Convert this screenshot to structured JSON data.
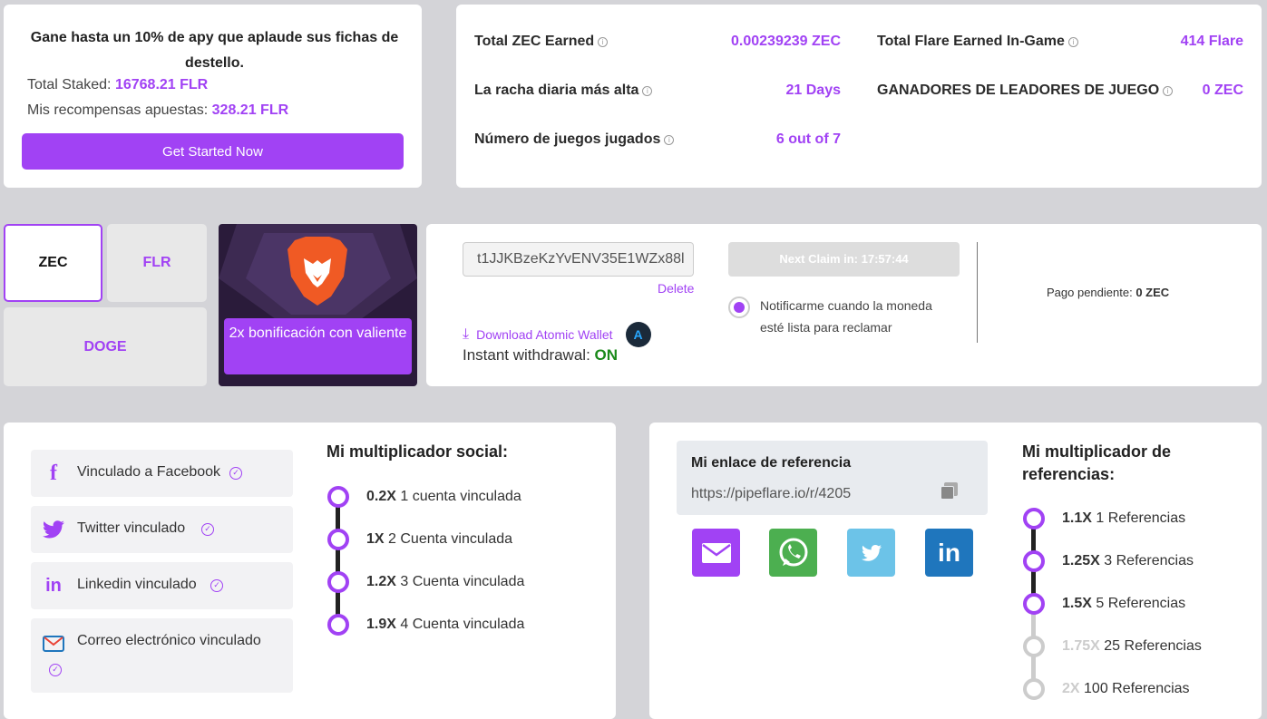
{
  "stake": {
    "headline": "Gane hasta un 10% de apy que aplaude sus fichas de destello.",
    "total_staked_label": "Total Staked:",
    "total_staked_value": "16768.21 FLR",
    "rewards_label": "Mis recompensas apuestas:",
    "rewards_value": "328.21 FLR",
    "button": "Get Started Now"
  },
  "stats": {
    "total_zec_label": "Total ZEC Earned",
    "total_zec_value": "0.00239239 ZEC",
    "streak_label": "La racha diaria más alta",
    "streak_value": "21 Days",
    "games_label": "Número de juegos jugados",
    "games_value": "6 out of 7",
    "flare_label": "Total Flare Earned In-Game",
    "flare_value": "414 Flare",
    "leaders_label": "GANADORES DE LEADORES DE JUEGO",
    "leaders_value": "0 ZEC"
  },
  "coins": {
    "zec": "ZEC",
    "flr": "FLR",
    "doge": "DOGE"
  },
  "brave": {
    "label": "2x bonificación con valiente"
  },
  "wallet": {
    "address": "t1JJKBzeKzYvENV35E1WZx88l",
    "delete": "Delete",
    "download": "Download Atomic Wallet",
    "withdraw_label": "Instant withdrawal:",
    "withdraw_value": "ON",
    "claim": "Next Claim in: 17:57:44",
    "notify": "Notificarme cuando la moneda esté lista para reclamar",
    "pending_label": "Pago pendiente:",
    "pending_value": "0 ZEC"
  },
  "social": {
    "links": [
      "Vinculado a Facebook",
      "Twitter vinculado",
      "Linkedin vinculado",
      "Correo electrónico vinculado"
    ],
    "title": "Mi multiplicador social:",
    "tiers": [
      {
        "mult": "0.2X",
        "text": "1 cuenta vinculada"
      },
      {
        "mult": "1X",
        "text": "2 Cuenta vinculada"
      },
      {
        "mult": "1.2X",
        "text": "3 Cuenta vinculada"
      },
      {
        "mult": "1.9X",
        "text": "4 Cuenta vinculada"
      }
    ]
  },
  "referral": {
    "box_title": "Mi enlace de referencia",
    "link": "https://pipeflare.io/r/4205",
    "title": "Mi multiplicador de referencias:",
    "tiers": [
      {
        "mult": "1.1X",
        "text": "1 Referencias"
      },
      {
        "mult": "1.25X",
        "text": "3 Referencias"
      },
      {
        "mult": "1.5X",
        "text": "5 Referencias"
      },
      {
        "mult": "1.75X",
        "text": "25 Referencias"
      },
      {
        "mult": "2X",
        "text": "100 Referencias"
      }
    ]
  },
  "colors": {
    "accent": "#a142f4",
    "on": "#1a8a1a",
    "whatsapp": "#4caf50",
    "twitter": "#6cc3e8",
    "linkedin": "#1f76bd"
  }
}
